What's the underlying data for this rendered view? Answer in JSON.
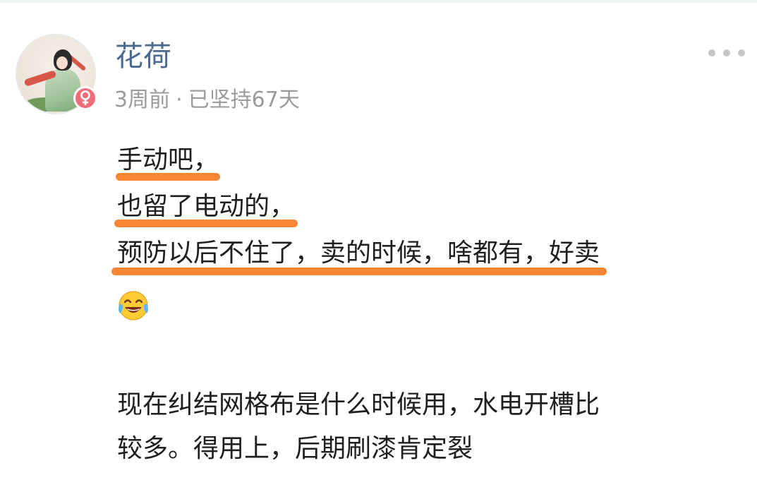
{
  "post": {
    "author": {
      "name": "花荷",
      "avatar_icon": "avatar-image",
      "gender_icon": "female-icon",
      "gender_color": "#f06d79"
    },
    "meta": {
      "time_ago": "3周前",
      "separator": "·",
      "streak": "已坚持67天"
    },
    "more_icon": "more-dots-icon",
    "body": {
      "lines": [
        "手动吧，",
        "也留了电动的，",
        "预防以后不住了，卖的时候，啥都有，好卖"
      ],
      "emoji_icon": "tears-of-joy-emoji-icon",
      "highlight_color": "#f58634",
      "paragraph2": [
        "现在纠结网格布是什么时候用，水电开槽比",
        "较多。得用上，后期刷漆肯定裂"
      ]
    }
  }
}
